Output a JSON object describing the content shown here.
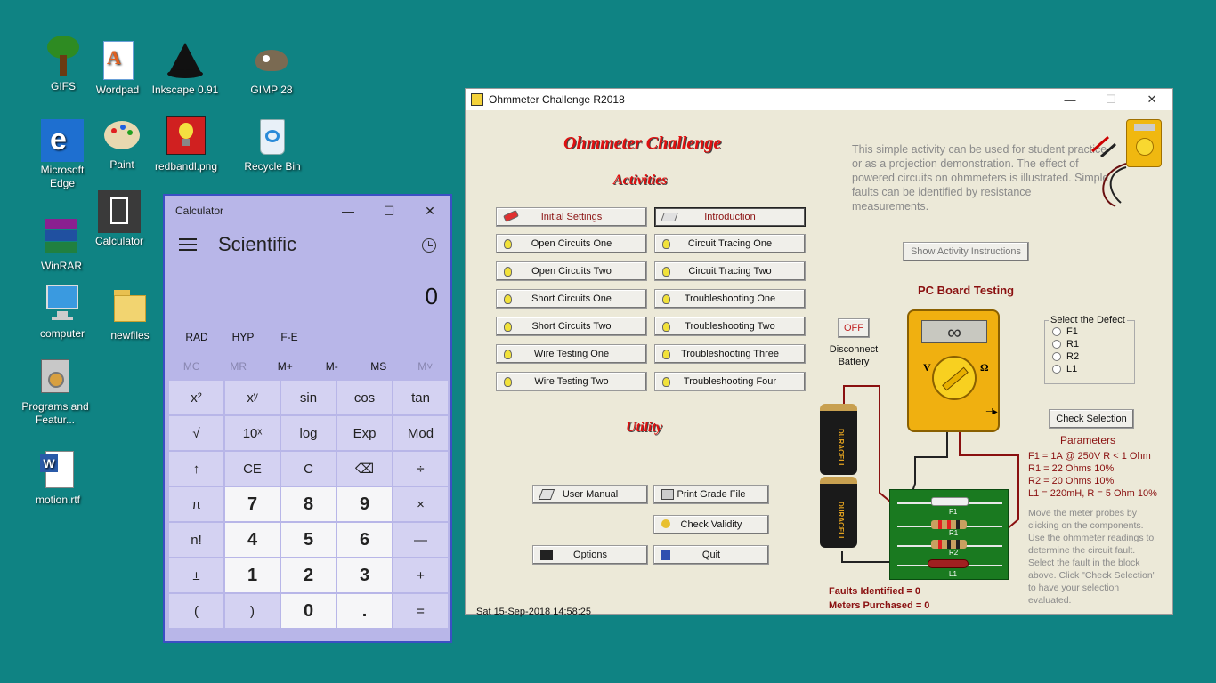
{
  "desktop": {
    "icons": [
      {
        "label": "GIFS"
      },
      {
        "label": "Wordpad"
      },
      {
        "label": "Inkscape 0.91"
      },
      {
        "label": "GIMP 28"
      },
      {
        "label": "Microsoft Edge"
      },
      {
        "label": "Paint"
      },
      {
        "label": "redbandl.png"
      },
      {
        "label": "Recycle Bin"
      },
      {
        "label": "WinRAR"
      },
      {
        "label": "Calculator"
      },
      {
        "label": "computer"
      },
      {
        "label": "newfiles"
      },
      {
        "label": "Programs and Featur..."
      },
      {
        "label": "motion.rtf"
      }
    ]
  },
  "calculator": {
    "title": "Calculator",
    "mode": "Scientific",
    "display": "0",
    "angle_modes": [
      "RAD",
      "HYP",
      "F-E"
    ],
    "memory": [
      "MC",
      "MR",
      "M+",
      "M-",
      "MS",
      "M˅"
    ],
    "buttons": [
      "x²",
      "xʸ",
      "sin",
      "cos",
      "tan",
      "√",
      "10ˣ",
      "log",
      "Exp",
      "Mod",
      "↑",
      "CE",
      "C",
      "⌫",
      "÷",
      "π",
      "7",
      "8",
      "9",
      "×",
      "n!",
      "4",
      "5",
      "6",
      "—",
      "±",
      "1",
      "2",
      "3",
      "+",
      "(",
      ")",
      "0",
      ".",
      "="
    ]
  },
  "ohm": {
    "window_title": "Ohmmeter Challenge   R2018",
    "app_title": "Ohmmeter Challenge",
    "activities_heading": "Activities",
    "utility_heading": "Utility",
    "activities_left": [
      "Initial Settings",
      "Open Circuits One",
      "Open Circuits Two",
      "Short Circuits One",
      "Short Circuits Two",
      "Wire Testing One",
      "Wire Testing Two"
    ],
    "activities_right": [
      "Introduction",
      "Circuit Tracing One",
      "Circuit Tracing Two",
      "Troubleshooting One",
      "Troubleshooting Two",
      "Troubleshooting Three",
      "Troubleshooting Four"
    ],
    "utility": {
      "user_manual": "User Manual",
      "print_grade": "Print Grade File",
      "check_validity": "Check Validity",
      "options": "Options",
      "quit": "Quit"
    },
    "description": "This simple activity can be used for student practice or as a projection demonstration. The effect of powered circuits on ohmmeters is illustrated. Simple faults can be identified by resistance measurements.",
    "show_instructions": "Show Activity Instructions",
    "pcb_heading": "PC Board Testing",
    "off_button": "OFF",
    "disconnect_label": "Disconnect Battery",
    "meter_readout": "∞",
    "select_defect": "Select the Defect",
    "defects": [
      "F1",
      "R1",
      "R2",
      "L1"
    ],
    "check_selection": "Check Selection",
    "parameters_heading": "Parameters",
    "parameters": [
      "F1 = 1A @ 250V   R < 1 Ohm",
      "R1 = 22 Ohms   10%",
      "R2 = 20 Ohms   10%",
      "L1 = 220mH,   R = 5 Ohm 10%"
    ],
    "help_text": "Move the meter probes by clicking on the components. Use the ohmmeter readings to determine the circuit fault. Select the fault in the block above. Click \"Check Selection\" to have your selection evaluated.",
    "faults_identified": "Faults Identified = 0",
    "meters_purchased": "Meters Purchased  = 0",
    "status_date": "Sat   15-Sep-2018   14:58:25",
    "battery_label": "DURACELL",
    "pcb_labels": [
      "F1",
      "R1",
      "R2",
      "L1"
    ]
  }
}
